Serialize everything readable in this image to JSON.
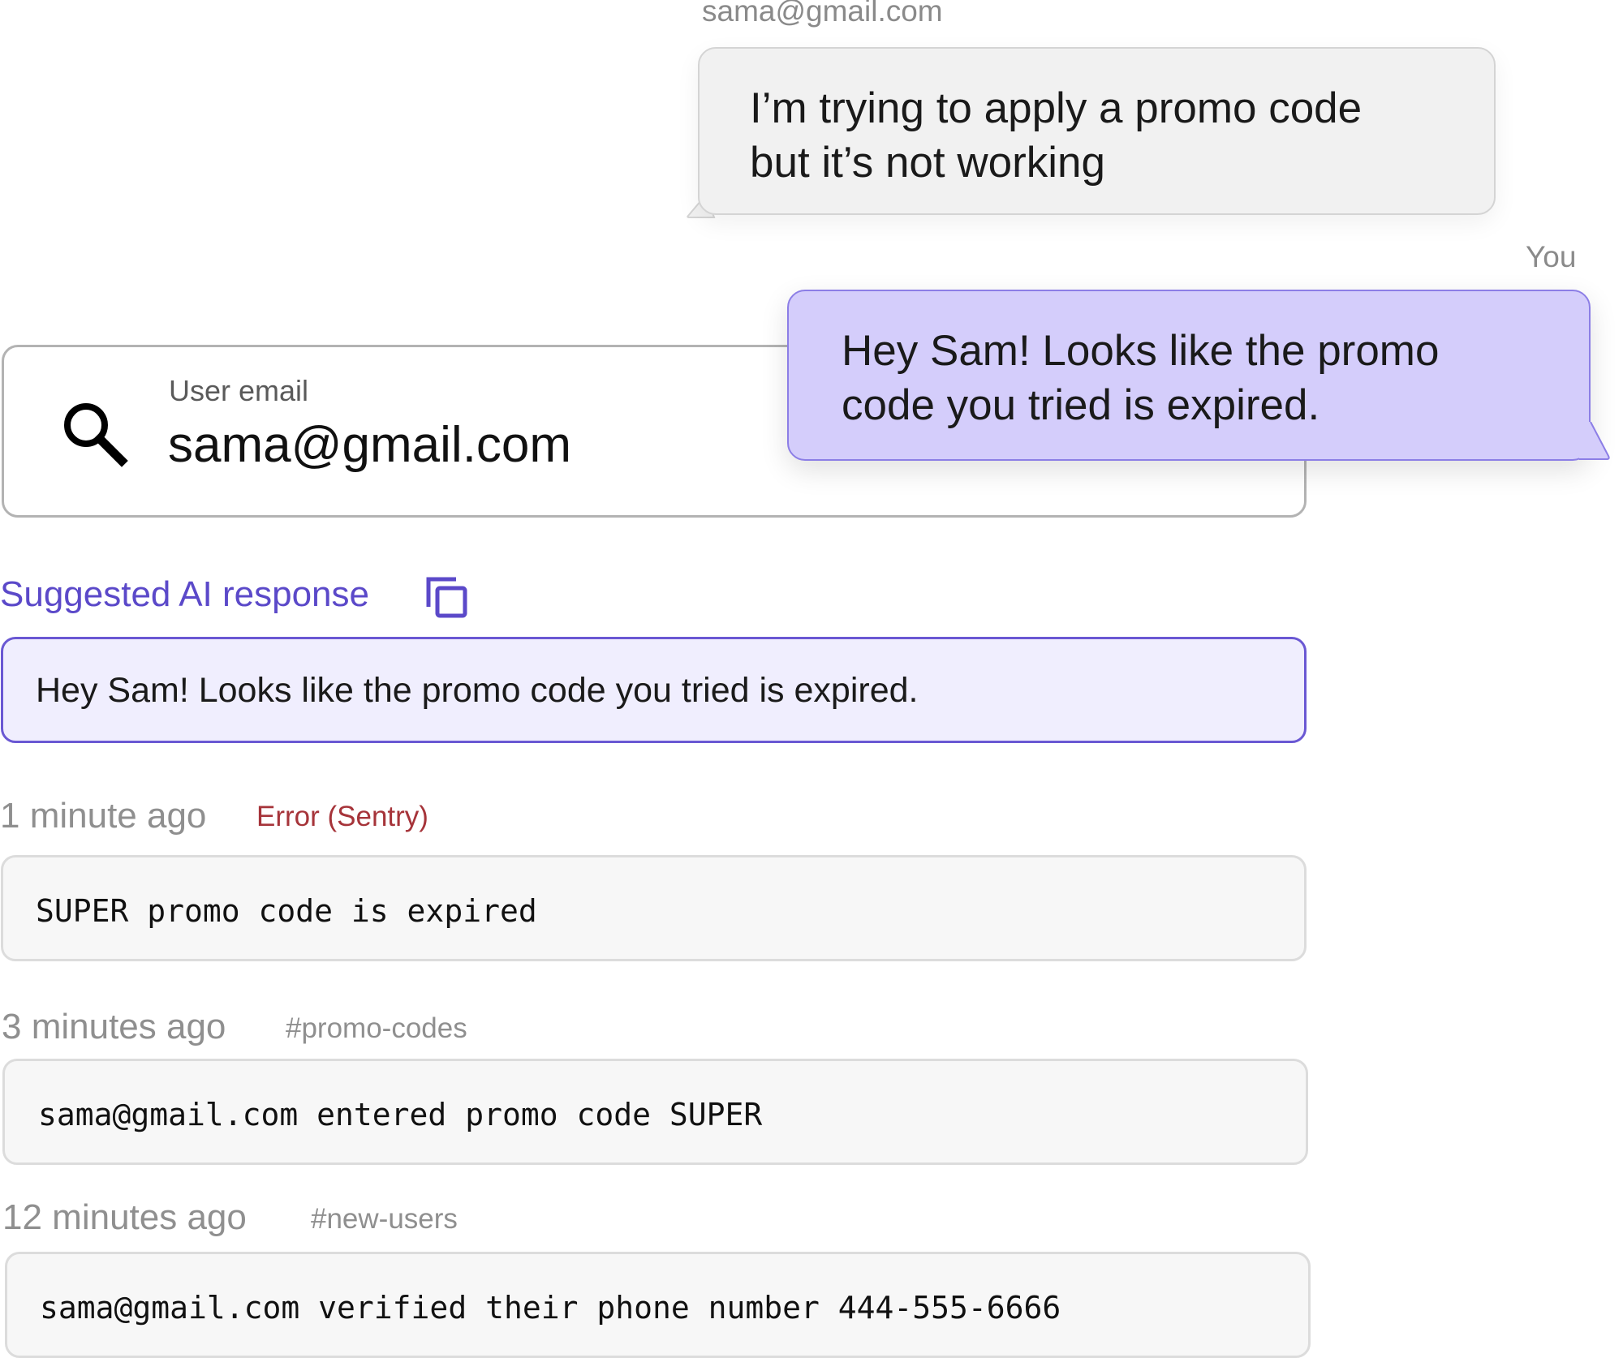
{
  "incoming_message": {
    "sender": "sama@gmail.com",
    "lines": [
      "I’m trying to apply a promo code",
      "but it’s not working"
    ]
  },
  "outgoing_message": {
    "sender": "You",
    "lines": [
      "Hey Sam! Looks like the promo",
      "code you tried is expired."
    ]
  },
  "search": {
    "label": "User email",
    "value": "sama@gmail.com",
    "icon": "search-icon"
  },
  "suggested_response": {
    "heading": "Suggested AI response",
    "copy_icon": "copy-icon",
    "text": "Hey Sam! Looks like the promo code you tried is expired."
  },
  "events": [
    {
      "time": "1 minute ago",
      "source": "Error (Sentry)",
      "source_color": "#a6343a",
      "message": "SUPER promo code is expired"
    },
    {
      "time": "3 minutes ago",
      "source": "#promo-codes",
      "source_color": "#8f8f8f",
      "message": "sama@gmail.com entered promo code SUPER"
    },
    {
      "time": "12 minutes ago",
      "source": "#new-users",
      "source_color": "#8f8f8f",
      "message": "sama@gmail.com verified their phone number 444-555-6666"
    }
  ],
  "colors": {
    "accent": "#5b49c9",
    "outgoing_bubble": "#d4cdfb",
    "incoming_bubble": "#f1f1f1",
    "ai_box": "#f0eefe"
  }
}
